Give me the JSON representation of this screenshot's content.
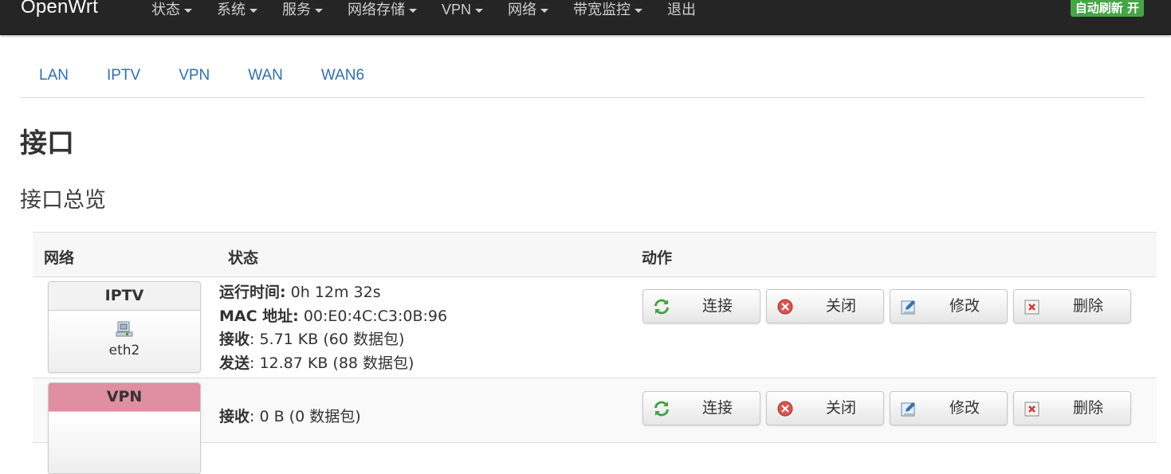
{
  "navbar": {
    "brand": "OpenWrt",
    "menu": [
      {
        "label": "状态",
        "dropdown": true
      },
      {
        "label": "系统",
        "dropdown": true
      },
      {
        "label": "服务",
        "dropdown": true
      },
      {
        "label": "网络存储",
        "dropdown": true
      },
      {
        "label": "VPN",
        "dropdown": true
      },
      {
        "label": "网络",
        "dropdown": true
      },
      {
        "label": "带宽监控",
        "dropdown": true
      },
      {
        "label": "退出",
        "dropdown": false
      }
    ],
    "refresh_badge": "自动刷新 开"
  },
  "tabs": [
    "LAN",
    "IPTV",
    "VPN",
    "WAN",
    "WAN6"
  ],
  "page_title": "接口",
  "section_title": "接口总览",
  "table": {
    "headers": [
      "网络",
      "状态",
      "动作"
    ],
    "rows": [
      {
        "name": "IPTV",
        "device": "eth2",
        "header_color": "#f2f2f2",
        "status": [
          {
            "label": "运行时间:",
            "value": " 0h 12m 32s"
          },
          {
            "label": "MAC 地址:",
            "value": " 00:E0:4C:C3:0B:96"
          },
          {
            "label": "接收",
            "value": ": 5.71 KB (60 数据包)"
          },
          {
            "label": "发送",
            "value": ": 12.87 KB (88 数据包)"
          }
        ]
      },
      {
        "name": "VPN",
        "header_color": "#e08ea1",
        "status": [
          {
            "label": "接收",
            "value": ": 0 B (0 数据包)"
          }
        ]
      }
    ],
    "actions": [
      {
        "label": "连接",
        "icon": "reload-icon"
      },
      {
        "label": "关闭",
        "icon": "stop-icon"
      },
      {
        "label": "修改",
        "icon": "edit-icon"
      },
      {
        "label": "删除",
        "icon": "delete-icon"
      }
    ]
  },
  "colors": {
    "navbar_bg": "#252525",
    "link": "#2f6fb5",
    "badge": "#46a546",
    "vpn_header": "#e08ea1"
  }
}
